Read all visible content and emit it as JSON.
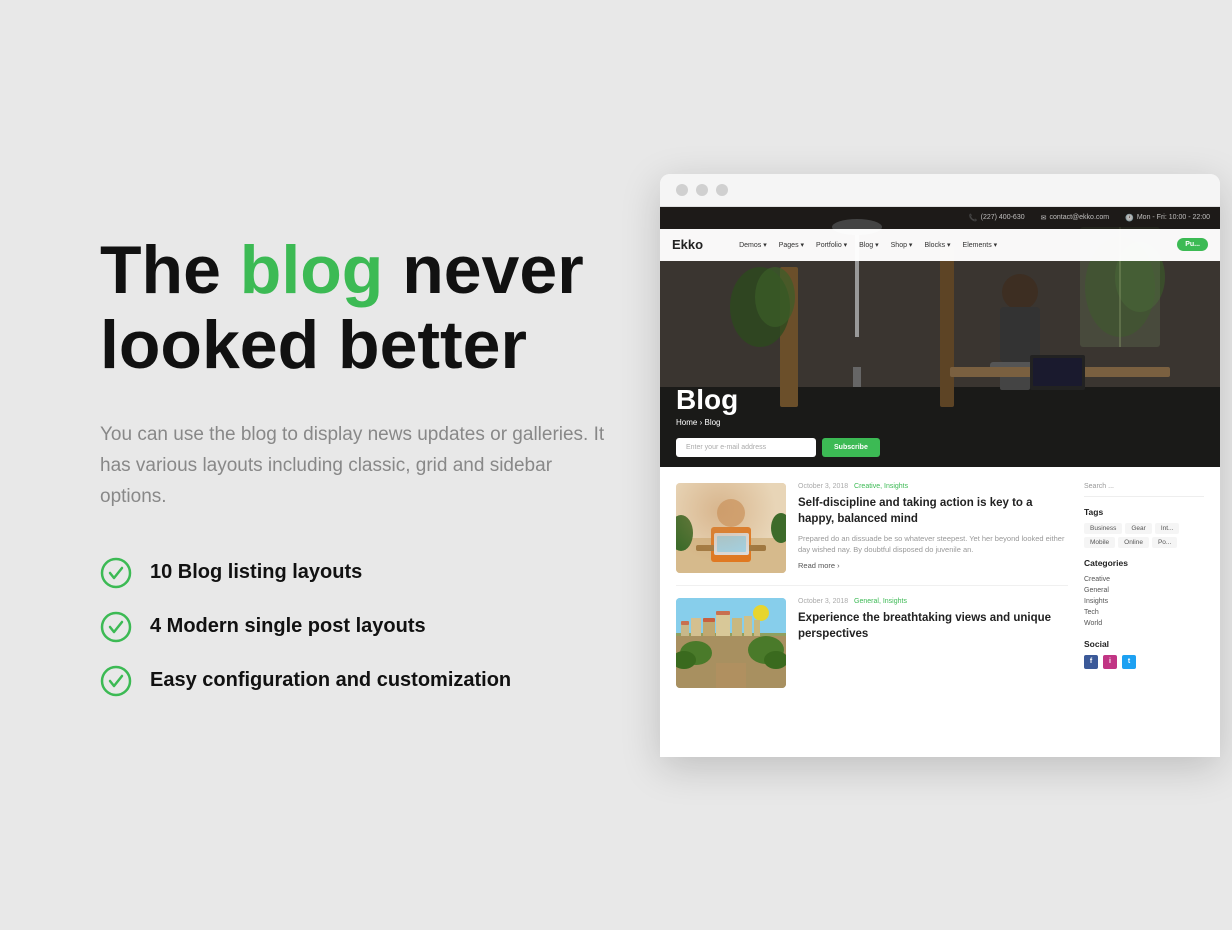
{
  "page": {
    "background_color": "#e8e8e8"
  },
  "left": {
    "headline_part1": "The ",
    "headline_green": "blog",
    "headline_part2": " never",
    "headline_line2": "looked better",
    "description": "You can use the blog to display news updates or galleries. It has various layouts including classic, grid and sidebar options.",
    "features": [
      {
        "id": "feat1",
        "text": "10 Blog listing layouts"
      },
      {
        "id": "feat2",
        "text": "4 Modern single post layouts"
      },
      {
        "id": "feat3",
        "text": "Easy configuration and customization"
      }
    ]
  },
  "right": {
    "browser": {
      "dots": [
        "red",
        "yellow",
        "green"
      ]
    },
    "blog_header": {
      "topbar": {
        "phone": "(227) 400-630",
        "email": "contact@ekko.com",
        "hours": "Mon - Fri: 10:00 - 22:00"
      },
      "nav": {
        "logo": "Ekko",
        "items": [
          "Demos",
          "Pages",
          "Portfolio",
          "Blog",
          "Shop",
          "Blocks",
          "Elements"
        ],
        "cta": "Pu..."
      },
      "title": "Blog",
      "breadcrumb_home": "Home",
      "breadcrumb_sep": "›",
      "breadcrumb_current": "Blog",
      "email_placeholder": "Enter your e-mail address",
      "subscribe_label": "Subscribe"
    },
    "blog_posts": [
      {
        "date": "October 3, 2018",
        "categories": "Creative, Insights",
        "title": "Self-discipline and taking action is key to a happy, balanced mind",
        "excerpt": "Prepared do an dissuade be so whatever steepest. Yet her beyond looked either day wished nay. By doubtful disposed do juvenile an.",
        "read_more": "Read more ›",
        "thumb_type": "office"
      },
      {
        "date": "October 3, 2018",
        "categories": "General, Insights",
        "title": "Experience the breathtaking views and unique perspectives",
        "excerpt": "",
        "read_more": "",
        "thumb_type": "city"
      }
    ],
    "sidebar": {
      "search_placeholder": "Search ...",
      "tags_title": "Tags",
      "tags": [
        "Business",
        "Gear",
        "Int...",
        "Mobile",
        "Online",
        "Po..."
      ],
      "categories_title": "Categories",
      "categories": [
        "Creative",
        "General",
        "Insights",
        "Tech",
        "World"
      ],
      "social_title": "Social",
      "social": [
        {
          "platform": "facebook",
          "label": "f"
        },
        {
          "platform": "instagram",
          "label": "i"
        },
        {
          "platform": "twitter",
          "label": "t"
        }
      ]
    }
  }
}
